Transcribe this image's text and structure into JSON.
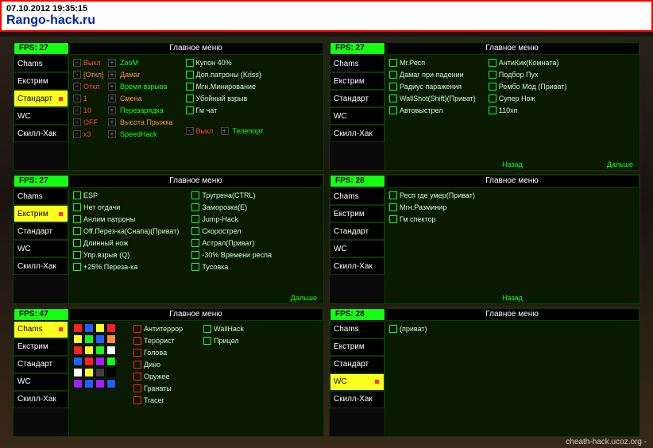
{
  "timestamp": "07.10.2012 19:35:15",
  "site": "Rango-hack.ru",
  "footer": "cheath-hack.ucoz.org -",
  "panels": [
    {
      "fps": "FPS: 27",
      "title": "Главное меню",
      "tabs": [
        "Chams",
        "Екстрим",
        "Стандарт",
        "WC",
        "Скилл-Хак"
      ],
      "active": 2,
      "type": "adjust",
      "adjust": [
        {
          "v": "Выкл",
          "vc": "red",
          "f": "ZooM",
          "fc": "green"
        },
        {
          "v": "[Откл]",
          "vc": "orange",
          "f": "Дамаг",
          "fc": "orange"
        },
        {
          "v": "Откл",
          "vc": "red",
          "f": "Время взрыва",
          "fc": "green"
        },
        {
          "v": "1",
          "vc": "red",
          "f": "Смена",
          "fc": "orange"
        },
        {
          "v": "10",
          "vc": "red",
          "f": "Перезарядка",
          "fc": "green"
        },
        {
          "v": "OFF",
          "vc": "red",
          "f": "Высота Прыжка",
          "fc": "orange"
        },
        {
          "v": "x3",
          "vc": "red",
          "f": "SpeedHack",
          "fc": "green"
        }
      ],
      "checks": [
        "Купон 40%",
        "Доп.патроны (Kriss)",
        "Мгн.Минирование",
        "Убойный взрыв",
        "Гм чат"
      ],
      "tele": {
        "v": "Выкл",
        "f": "Телепорт"
      }
    },
    {
      "fps": "FPS: 27",
      "title": "Главное меню",
      "tabs": [
        "Chams",
        "Екстрим",
        "Стандарт",
        "WC",
        "Скилл-Хак"
      ],
      "active": -1,
      "type": "checks2",
      "col1": [
        "Мг.Респ",
        "Дамаг при падении",
        "Радиус паражения",
        "WallShot(Shift)(Приват)",
        "Автовыстрел"
      ],
      "col2": [
        "АнтиКик(Комната)",
        "Подбор Пух",
        "Рембо Мод (Приват)",
        "Супер Нож",
        "110хп"
      ],
      "navLeft": "Назад",
      "navRight": "Дальше"
    },
    {
      "fps": "FPS: 27",
      "title": "Главное меню",
      "tabs": [
        "Chams",
        "Екстрим",
        "Стандарт",
        "WC",
        "Скилл-Хак"
      ],
      "active": 1,
      "type": "checks2",
      "col1": [
        "ESP",
        "Нет отдачи",
        "Анлим патроны",
        "Off.Перез-ка(Снапа)(Приват)",
        "Длинный нож",
        "Упр.взрыв (Q)",
        "+25% Переза-ка"
      ],
      "col2": [
        "Тругрена(CTRL)",
        "Заморозка(E)",
        "Jump-Hack",
        "Скорострел",
        "Астрал(Приват)",
        "-30% Времени респа",
        "Тусовка"
      ],
      "navRight": "Дальше"
    },
    {
      "fps": "FPS: 28",
      "title": "Главное меню",
      "tabs": [
        "Chams",
        "Екстрим",
        "Стандарт",
        "WC",
        "Скилл-Хак"
      ],
      "active": -1,
      "type": "checks1",
      "col1": [
        "Респ где умер(Приват)",
        "Мгн.Разминир",
        "Гм спектор"
      ],
      "navLeft": "Назад"
    },
    {
      "fps": "FPS: 47",
      "title": "Главное меню",
      "tabs": [
        "Chams",
        "Екстрим",
        "Стандарт",
        "WC",
        "Скилл-Хак"
      ],
      "active": 0,
      "type": "palette",
      "paletteCols": [
        [
          "#ff2020",
          "#ffff20",
          "#ff2020",
          "#2060ff",
          "#ffffff",
          "#a020ff"
        ],
        [
          "#2060ff",
          "#14ff14",
          "#ffff20",
          "#ff2020",
          "#ffff20",
          "#2060ff"
        ],
        [
          "#ffff20",
          "#2060ff",
          "#14ff14",
          "#a020ff",
          "#404040",
          "#a020ff"
        ],
        [
          "#ff2020",
          "#ff9030",
          "#ffffff",
          "#14ff14",
          "#000000",
          "#2060ff"
        ]
      ],
      "reds": [
        "Антитеррор",
        "Терорист",
        "Голова",
        "Дино",
        "Оружее",
        "Гранаты",
        "Tracer"
      ],
      "col2": [
        "WallHack",
        "Прицел"
      ]
    },
    {
      "fps": "FPS: 28",
      "title": "Главное меню",
      "tabs": [
        "Chams",
        "Екстрим",
        "Стандарт",
        "WC",
        "Скилл-Хак"
      ],
      "active": 3,
      "type": "checks1",
      "col1": [
        "(приват)"
      ]
    }
  ]
}
